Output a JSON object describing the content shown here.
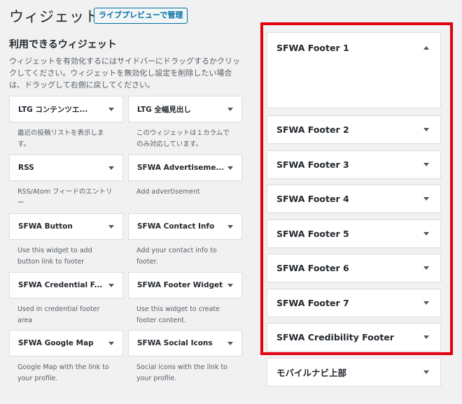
{
  "header": {
    "title": "ウィジェット",
    "live_preview_label": "ライブプレビューで管理"
  },
  "available": {
    "title": "利用できるウィジェット",
    "description": "ウィジェットを有効化するにはサイドバーにドラッグするかクリックしてください。ウィジェットを無効化し設定を削除したい場合は、ドラッグして右側に戻してください。",
    "widgets": [
      {
        "title": "LTG コンテンツエ...",
        "desc": "最近の投稿リストを表示します。"
      },
      {
        "title": "LTG 全幅見出し",
        "desc": "このウィジェットは１カラムでのみ対応しています。"
      },
      {
        "title": "RSS",
        "desc": "RSS/Atom フィードのエントリー"
      },
      {
        "title": "SFWA Advertiseme...",
        "desc": "Add advertisement"
      },
      {
        "title": "SFWA Button",
        "desc": "Use this widget to add button link to footer"
      },
      {
        "title": "SFWA Contact Info",
        "desc": "Add your contact info to footer."
      },
      {
        "title": "SFWA Credential F...",
        "desc": "Used in credential footer area"
      },
      {
        "title": "SFWA Footer Widget",
        "desc": "Use this widget to create footer content."
      },
      {
        "title": "SFWA Google Map",
        "desc": "Google Map with the link to your profile."
      },
      {
        "title": "SFWA Social Icons",
        "desc": "Social icons with the link to your profile."
      }
    ]
  },
  "sidebars": [
    {
      "title": "SFWA Footer 1",
      "open": true
    },
    {
      "title": "SFWA Footer 2",
      "open": false
    },
    {
      "title": "SFWA Footer 3",
      "open": false
    },
    {
      "title": "SFWA Footer 4",
      "open": false
    },
    {
      "title": "SFWA Footer 5",
      "open": false
    },
    {
      "title": "SFWA Footer 6",
      "open": false
    },
    {
      "title": "SFWA Footer 7",
      "open": false
    },
    {
      "title": "SFWA Credibility Footer",
      "open": false
    },
    {
      "title": "モバイルナビ上部",
      "open": false
    }
  ],
  "colors": {
    "highlight": "#e3000f",
    "link": "#0071a1"
  }
}
